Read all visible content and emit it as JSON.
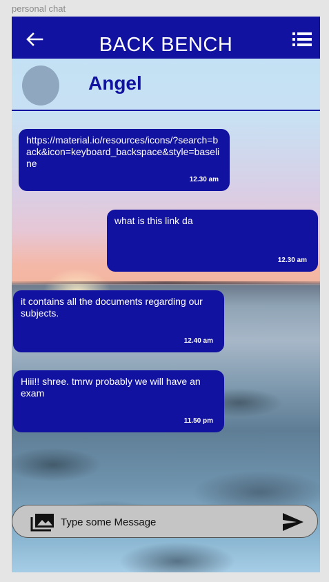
{
  "frame_label": "personal chat",
  "header": {
    "title": "BACK BENCH",
    "back_icon": "arrow-back-icon",
    "menu_icon": "list-menu-icon",
    "color": "#1212a0"
  },
  "contact": {
    "name": "Angel"
  },
  "messages": [
    {
      "text": "https://material.io/resources/icons/?search=back&icon=keyboard_backspace&style=baseline",
      "time": "12.30 am",
      "side": "left"
    },
    {
      "text": "what is this link da",
      "time": "12.30 am",
      "side": "right"
    },
    {
      "text": "it contains all the documents regarding our subjects.",
      "time": "12.40  am",
      "side": "left"
    },
    {
      "text": "Hiii!! shree. tmrw probably we will have an exam",
      "time": "11.50 pm",
      "side": "left"
    }
  ],
  "composer": {
    "placeholder": "Type some Message",
    "attach_icon": "photo-library-icon",
    "send_icon": "send-icon"
  }
}
